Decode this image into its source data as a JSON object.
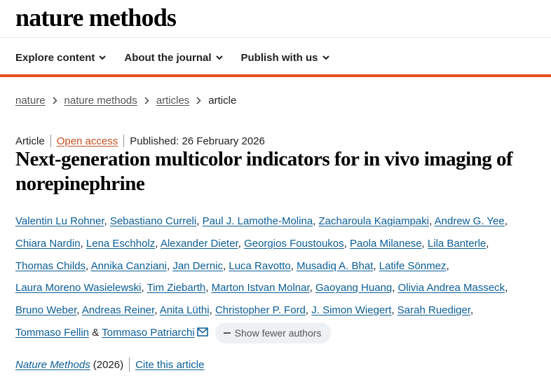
{
  "brand": "nature methods",
  "nav": [
    {
      "label": "Explore content"
    },
    {
      "label": "About the journal"
    },
    {
      "label": "Publish with us"
    }
  ],
  "breadcrumb": {
    "items": [
      "nature",
      "nature methods",
      "articles"
    ],
    "current": "article"
  },
  "article": {
    "type": "Article",
    "access": "Open access",
    "published": "Published: 26 February 2026",
    "title": "Next-generation multicolor indicators for in vivo imaging of norepinephrine"
  },
  "authors": [
    "Valentin Lu Rohner",
    "Sebastiano Curreli",
    "Paul J. Lamothe-Molina",
    "Zacharoula Kagiampaki",
    "Andrew G. Yee",
    "Chiara Nardin",
    "Lena Eschholz",
    "Alexander Dieter",
    "Georgios Foustoukos",
    "Paola Milanese",
    "Lila Banterle",
    "Thomas Childs",
    "Annika Canziani",
    "Jan Dernic",
    "Luca Ravotto",
    "Musadiq A. Bhat",
    "Latife Sönmez",
    "Laura Moreno Wasielewski",
    "Tim Ziebarth",
    "Marton Istvan Molnar",
    "Gaoyang Huang",
    "Olivia Andrea Masseck",
    "Bruno Weber",
    "Andreas Reiner",
    "Anita Lüthi",
    "Christopher P. Ford",
    "J. Simon Wiegert",
    "Sarah Ruediger",
    "Tommaso Fellin",
    "Tommaso Patriarchi"
  ],
  "authors_separator": ",",
  "authors_conjunction": "&",
  "show_fewer_label": "Show fewer authors",
  "citation": {
    "journal": "Nature Methods",
    "year": "(2026)",
    "cite_label": "Cite this article"
  },
  "colors": {
    "accent": "#e8501e",
    "link": "#0b5e96",
    "open_access": "#c4501e"
  },
  "icons": [
    "chevron-down-icon",
    "chevron-right-icon",
    "mail-icon",
    "minus-icon"
  ]
}
